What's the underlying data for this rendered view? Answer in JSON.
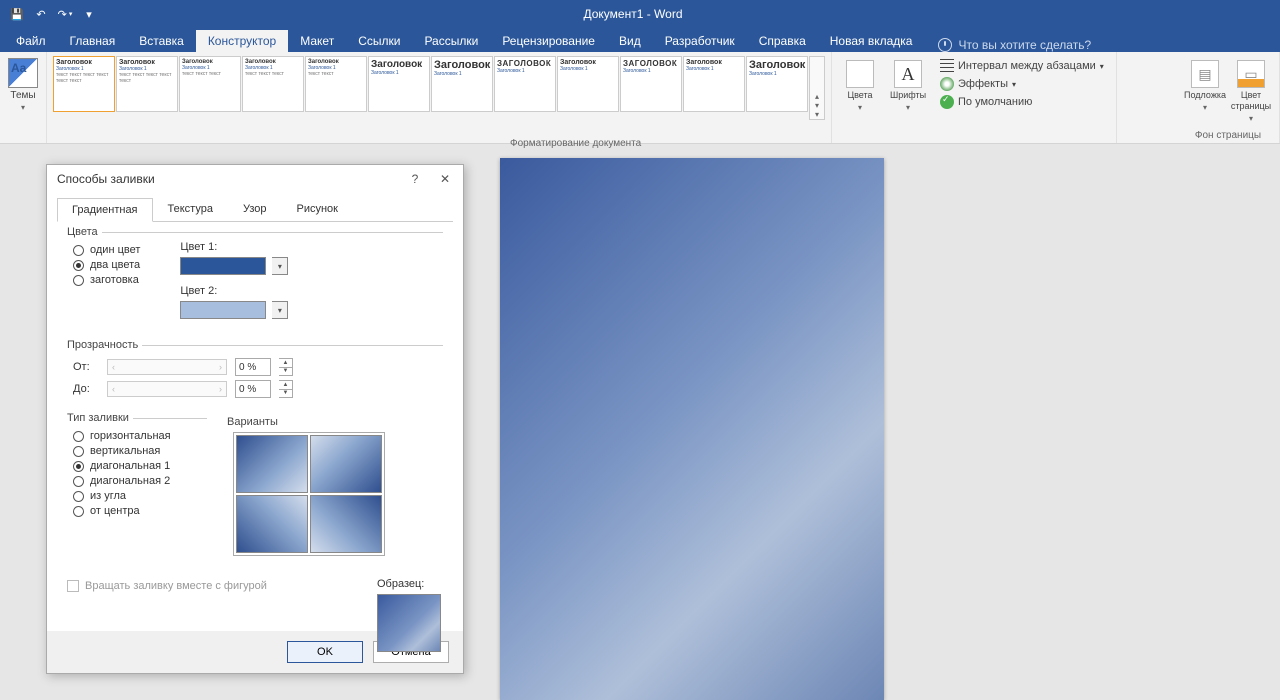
{
  "titlebar": {
    "title": "Документ1 - Word"
  },
  "qat": {
    "save": "💾",
    "undo": "↶",
    "redo": "↷",
    "touch": "▾"
  },
  "tabs": [
    "Файл",
    "Главная",
    "Вставка",
    "Конструктор",
    "Макет",
    "Ссылки",
    "Рассылки",
    "Рецензирование",
    "Вид",
    "Разработчик",
    "Справка",
    "Новая вкладка"
  ],
  "active_tab": "Конструктор",
  "tell_me": "Что вы хотите сделать?",
  "ribbon": {
    "themes": "Темы",
    "gallery_title": "Заголовок",
    "gallery_upper": "ЗАГОЛОВОК",
    "gallery_sub": "Заголовок 1",
    "doc_format": "Форматирование документа",
    "colors": "Цвета",
    "fonts": "Шрифты",
    "interval": "Интервал между абзацами",
    "effects": "Эффекты",
    "default": "По умолчанию",
    "watermark": "Подложка",
    "pagecolor": "Цвет страницы",
    "pageborders": "Фон страницы"
  },
  "dialog": {
    "title": "Способы заливки",
    "help": "?",
    "close": "✕",
    "tabs": [
      "Градиентная",
      "Текстура",
      "Узор",
      "Рисунок"
    ],
    "colors_group": "Цвета",
    "radio_one": "один цвет",
    "radio_two": "два цвета",
    "radio_preset": "заготовка",
    "color1_label": "Цвет 1:",
    "color2_label": "Цвет 2:",
    "color1": "#2b579a",
    "color2": "#a8bede",
    "transparency_group": "Прозрачность",
    "from": "От:",
    "to": "До:",
    "from_val": "0 %",
    "to_val": "0 %",
    "type_group": "Тип заливки",
    "type_h": "горизонтальная",
    "type_v": "вертикальная",
    "type_d1": "диагональная 1",
    "type_d2": "диагональная 2",
    "type_corner": "из угла",
    "type_center": "от центра",
    "variants": "Варианты",
    "sample": "Образец:",
    "rotate": "Вращать заливку вместе с фигурой",
    "ok": "OK",
    "cancel": "Отмена"
  }
}
